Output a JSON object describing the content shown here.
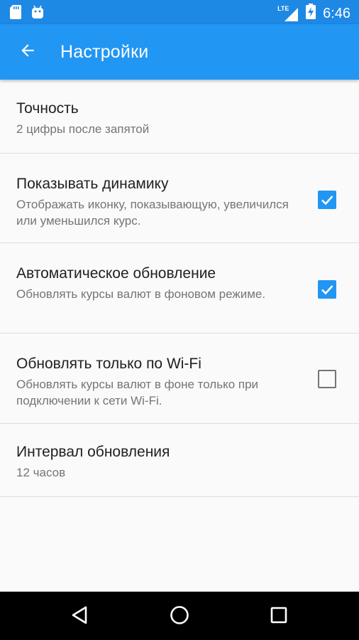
{
  "status_bar": {
    "time": "6:46",
    "network_label": "LTE",
    "icons": [
      "sd-card-icon",
      "android-icon",
      "lte-signal-icon",
      "battery-charging-icon"
    ]
  },
  "app_bar": {
    "title": "Настройки",
    "back_icon": "arrow-back-icon"
  },
  "preferences": [
    {
      "title": "Точность",
      "summary": "2 цифры после запятой",
      "checkbox": null
    },
    {
      "title": "Показывать динамику",
      "summary": "Отображать иконку, показывающую, увеличился или уменьшился курс.",
      "checkbox": true
    },
    {
      "title": "Автоматическое обновление",
      "summary": "Обновлять курсы валют в фоновом режиме.",
      "checkbox": true
    },
    {
      "title": "Обновлять только по Wi-Fi",
      "summary": "Обновлять курсы валют в фоне только при подключении к сети Wi-Fi.",
      "checkbox": false
    },
    {
      "title": "Интервал обновления",
      "summary": "12 часов",
      "checkbox": null
    }
  ],
  "nav_bar": {
    "icons": [
      "back-triangle-icon",
      "home-circle-icon",
      "recents-square-icon"
    ]
  },
  "colors": {
    "status_bar": "#1e88e5",
    "app_bar": "#2196f3",
    "accent": "#2196f3",
    "background": "#fafafa",
    "title_text": "#212121",
    "summary_text": "#757575",
    "divider": "#dcdcdc"
  }
}
